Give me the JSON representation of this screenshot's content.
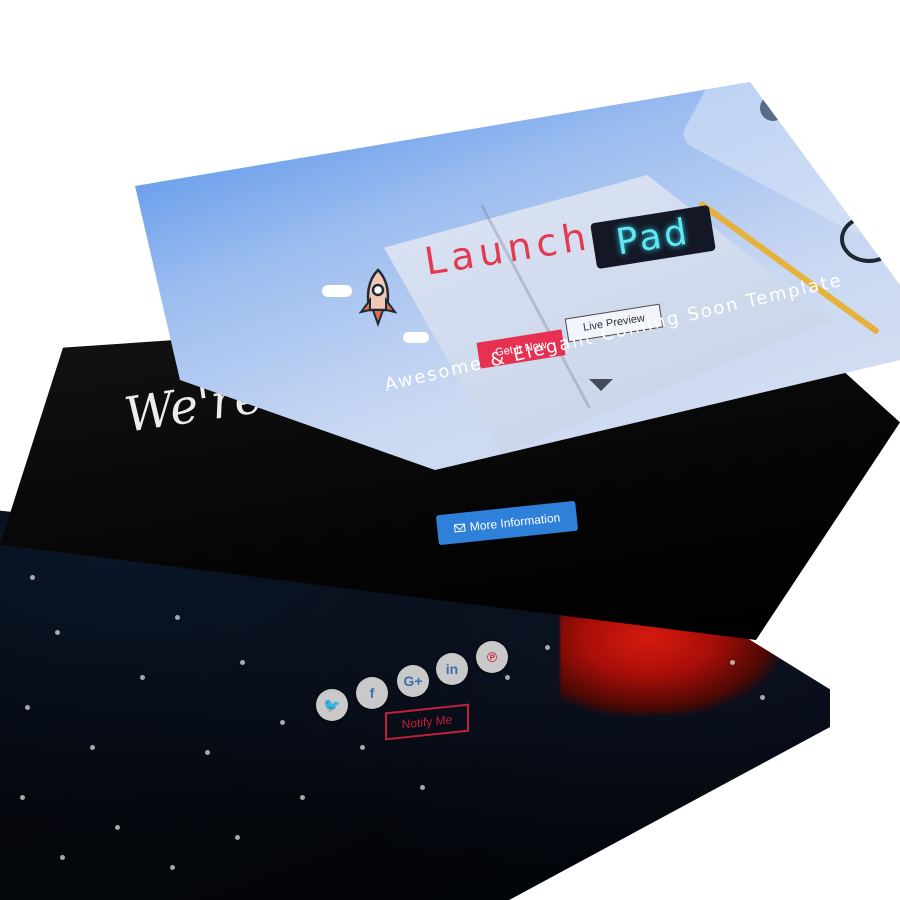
{
  "launchpad": {
    "logo_launch": "Launch",
    "logo_pad": "Pad",
    "get_it_label": "Get It Now",
    "live_preview_label": "Live Preview",
    "tagline": "Awesome & Elegant Coming Soon Template",
    "scroll_icon": "chevron-down-icon",
    "accent": "#e63152",
    "pad_glow": "#64e7f3"
  },
  "maintenance": {
    "title": "We're 'Under Maintenance",
    "more_info_label": "More Information",
    "button_icon": "envelope-icon",
    "button_color": "#2f80d8",
    "ribbon_color": "#e0620d"
  },
  "starry": {
    "social": [
      {
        "name": "twitter",
        "glyph": "🐦"
      },
      {
        "name": "facebook",
        "glyph": "f"
      },
      {
        "name": "google-plus",
        "glyph": "G+"
      },
      {
        "name": "linkedin",
        "glyph": "in"
      },
      {
        "name": "pinterest",
        "glyph": "℗"
      }
    ],
    "notify_label": "Notify Me",
    "notify_color": "#c0203a"
  }
}
